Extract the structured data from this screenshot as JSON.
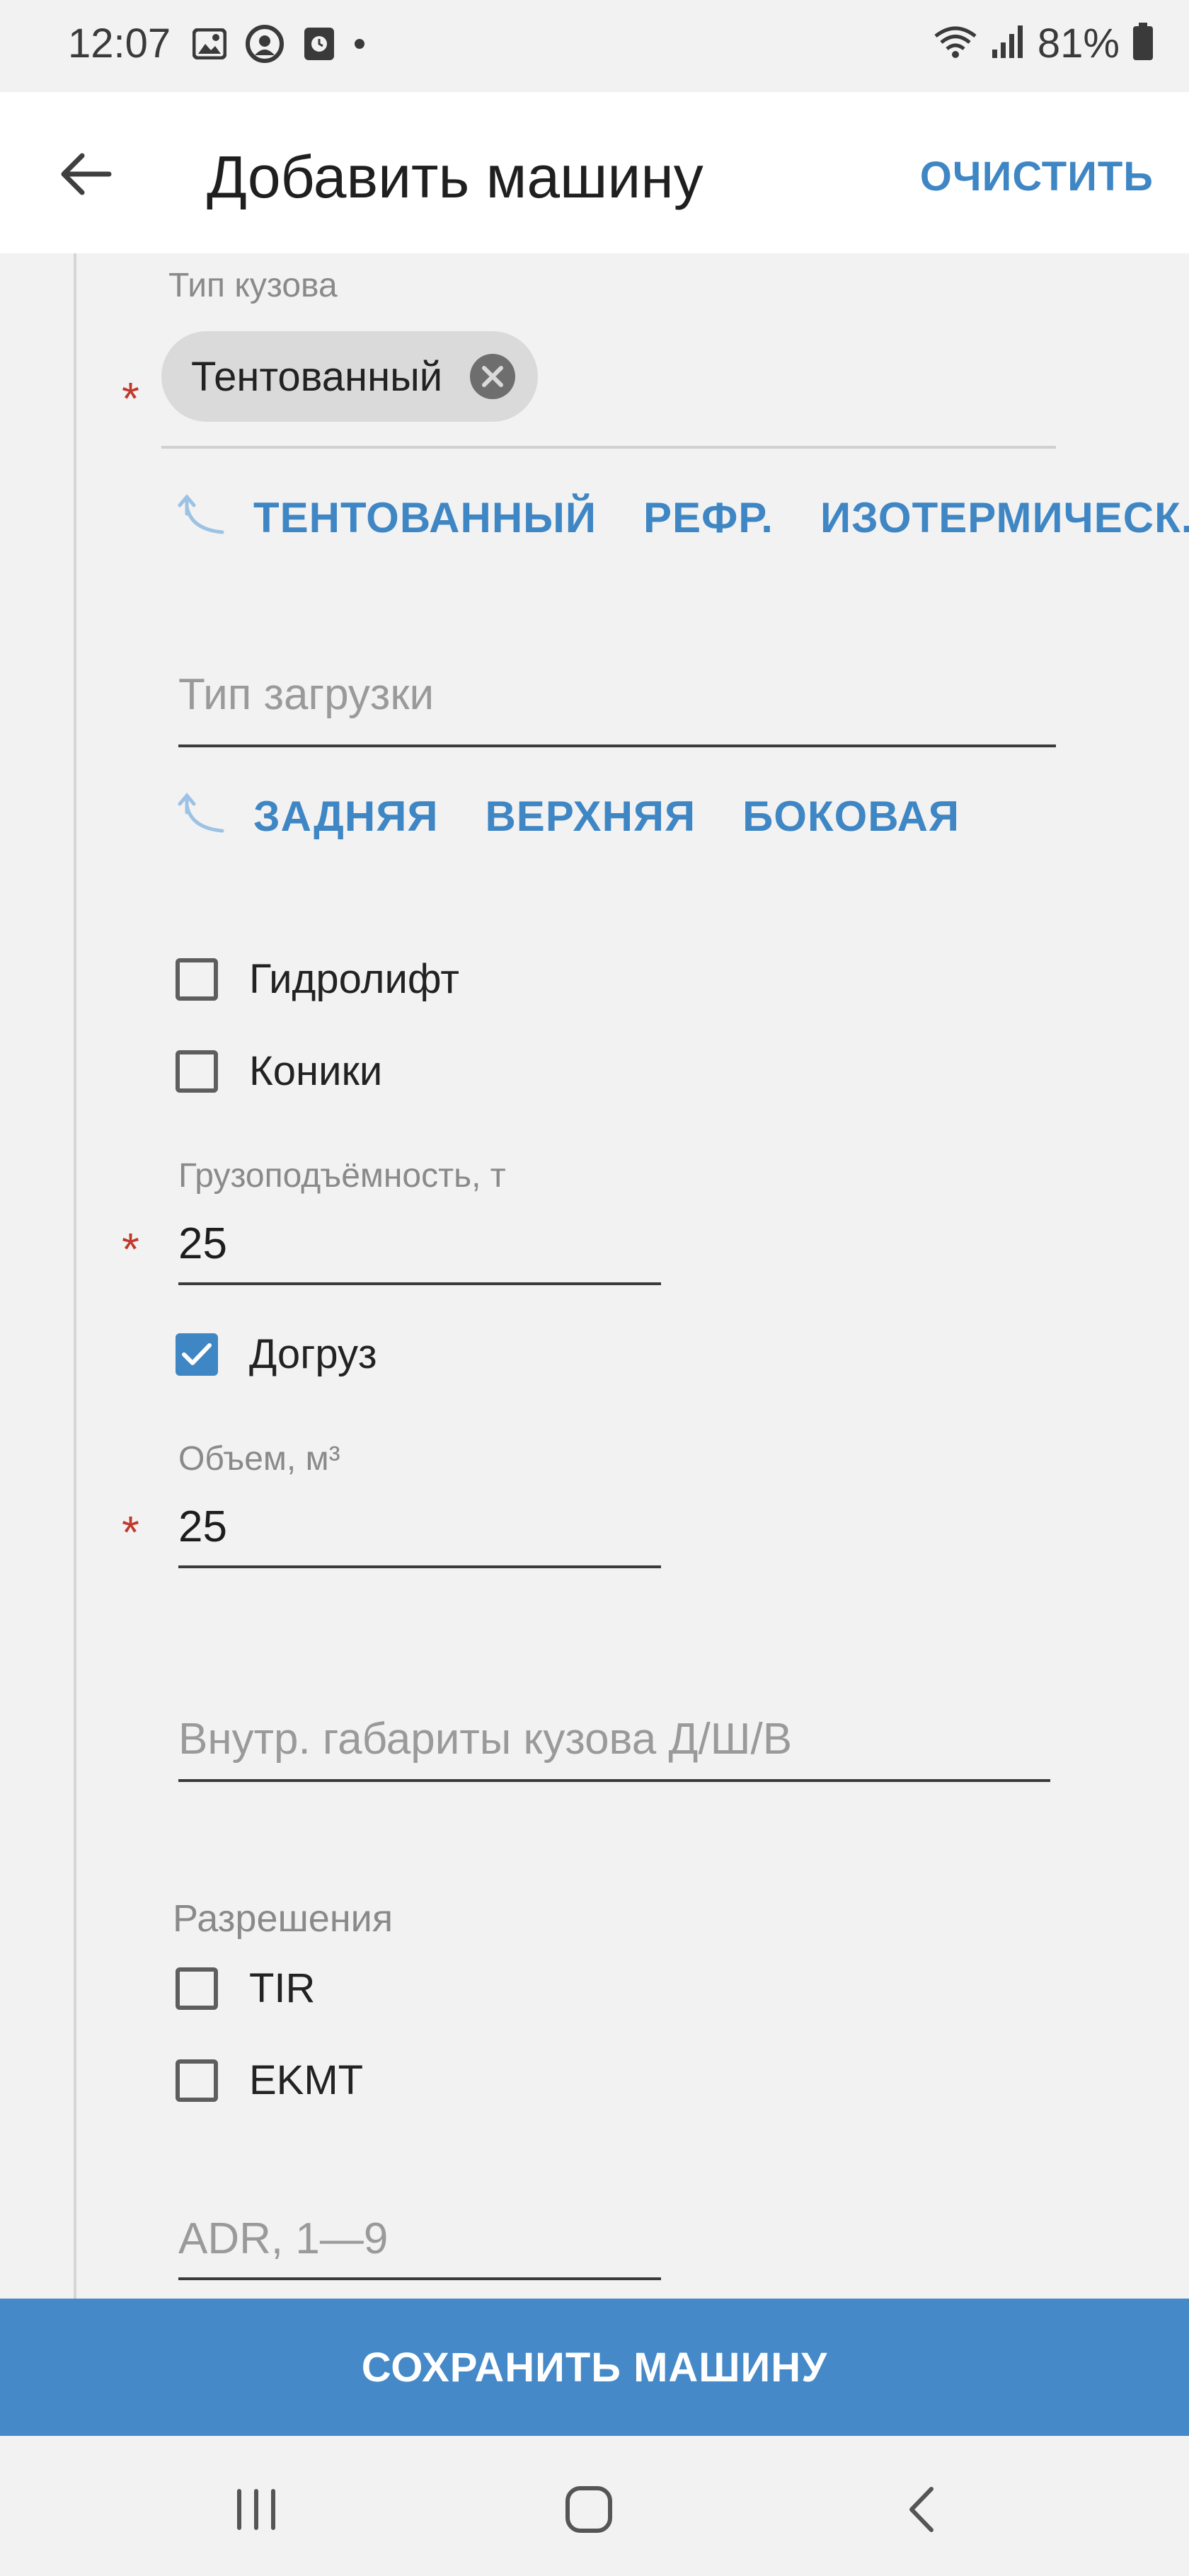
{
  "status_bar": {
    "time": "12:07",
    "battery": "81%",
    "icons": [
      "image-icon",
      "app-icon",
      "clock-icon",
      "dot-icon",
      "wifi-icon",
      "signal-icon",
      "battery-icon"
    ]
  },
  "app_bar": {
    "title": "Добавить машину",
    "clear_label": "ОЧИСТИТЬ"
  },
  "form": {
    "body_type": {
      "label": "Тип кузова",
      "required_mark": "*",
      "chip": "Тентованный",
      "suggestions": [
        "ТЕНТОВАННЫЙ",
        "РЕФР.",
        "ИЗОТЕРМИЧЕСК..."
      ]
    },
    "loading_type": {
      "placeholder": "Тип загрузки",
      "suggestions": [
        "ЗАДНЯЯ",
        "ВЕРХНЯЯ",
        "БОКОВАЯ"
      ]
    },
    "options": [
      {
        "label": "Гидролифт",
        "checked": false
      },
      {
        "label": "Коники",
        "checked": false
      }
    ],
    "capacity": {
      "label": "Грузоподъёмность, т",
      "required_mark": "*",
      "value": "25"
    },
    "extra_load": {
      "label": "Догруз",
      "checked": true
    },
    "volume": {
      "label": "Объем, м³",
      "required_mark": "*",
      "value": "25"
    },
    "dimensions": {
      "placeholder": "Внутр. габариты кузова Д/Ш/В"
    },
    "permits": {
      "title": "Разрешения",
      "items": [
        {
          "label": "TIR",
          "checked": false
        },
        {
          "label": "EKMT",
          "checked": false
        }
      ]
    },
    "adr": {
      "placeholder": "ADR, 1—9"
    }
  },
  "save_button": {
    "label": "СОХРАНИТЬ МАШИНУ"
  },
  "colors": {
    "accent": "#3f86c4",
    "save_bar": "#4589c8",
    "required": "#c0392b",
    "background": "#f2f2f2"
  }
}
